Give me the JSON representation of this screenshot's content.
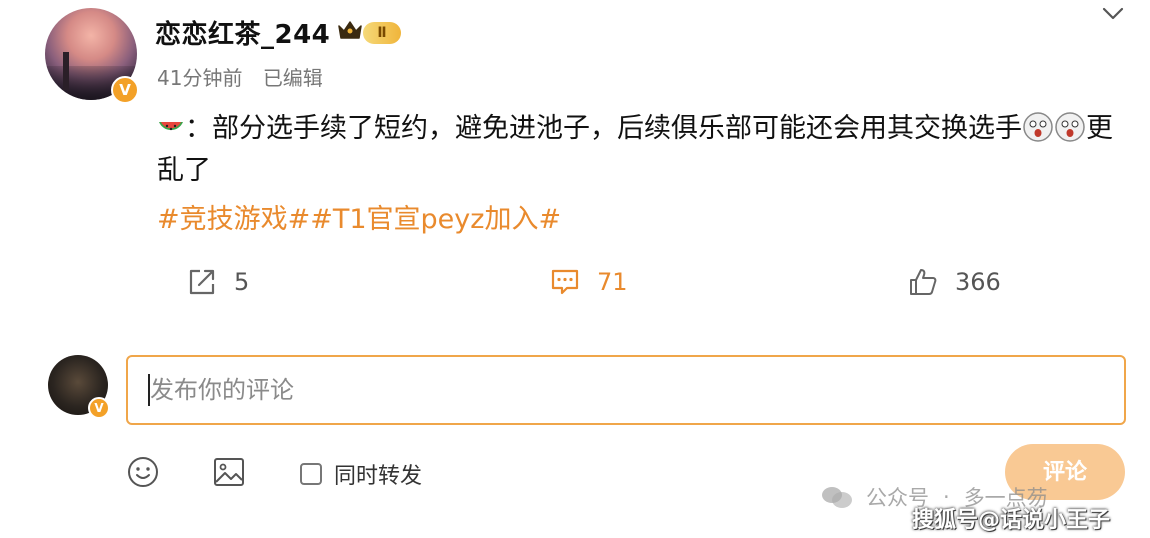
{
  "post": {
    "username": "恋恋红茶_244",
    "level_badge": "Ⅱ",
    "time": "41分钟前",
    "edited": "已编辑",
    "text_separator": "：",
    "text_main": "部分选手续了短约，避免进池子，后续俱乐部可能还会用其交换选手",
    "text_tail": "更乱了",
    "tags": "#竞技游戏##T1官宣peyz加入#",
    "verify_mark": "V"
  },
  "actions": {
    "repost_count": "5",
    "comment_count": "71",
    "like_count": "366"
  },
  "composer": {
    "placeholder": "发布你的评论",
    "also_repost_label": "同时转发",
    "submit_label": "评论",
    "verify_mark": "V"
  },
  "watermarks": {
    "wechat_text_1": "公众号",
    "wechat_text_2": "多一点芴",
    "sohu": "搜狐号@话说小王子"
  },
  "colors": {
    "accent_orange": "#e98a2d",
    "input_border": "#f0a64a",
    "submit_bg": "#f9c994",
    "verify_badge": "#f3a128"
  },
  "icons": {
    "repost": "repost-icon",
    "comment": "comment-icon",
    "like": "thumbs-up-icon",
    "emoji": "emoji-icon",
    "image": "image-icon",
    "expand": "chevron-down-icon"
  }
}
